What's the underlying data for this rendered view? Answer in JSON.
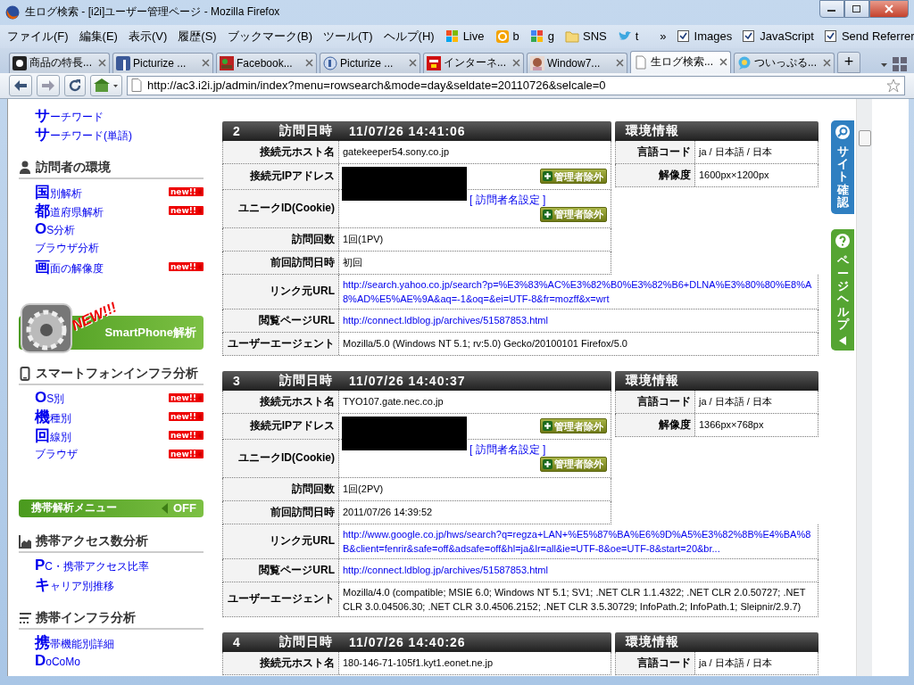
{
  "window": {
    "title": "生ログ検索 - [i2i]ユーザー管理ページ - Mozilla Firefox"
  },
  "menu": [
    "ファイル(F)",
    "編集(E)",
    "表示(V)",
    "履歴(S)",
    "ブックマーク(B)",
    "ツール(T)",
    "ヘルプ(H)"
  ],
  "bookmarks": [
    {
      "label": "Live",
      "kind": "flag"
    },
    {
      "label": "b",
      "kind": "ring"
    },
    {
      "label": "g",
      "kind": "tiles"
    },
    {
      "label": "SNS",
      "kind": "folder"
    },
    {
      "label": "t",
      "kind": "bird"
    }
  ],
  "overflow": "»",
  "toggles": [
    {
      "label": "Images",
      "checked": true
    },
    {
      "label": "JavaScript",
      "checked": true
    },
    {
      "label": "Send Referrer",
      "checked": true
    }
  ],
  "tabs": [
    {
      "label": "商品の特長...",
      "kind": "dark",
      "selected": false
    },
    {
      "label": "Picturize ...",
      "kind": "blue",
      "selected": false
    },
    {
      "label": "Facebook...",
      "kind": "photo",
      "selected": false
    },
    {
      "label": "Picturize ...",
      "kind": "circle",
      "selected": false
    },
    {
      "label": "インターネ...",
      "kind": "red",
      "selected": false
    },
    {
      "label": "Window7...",
      "kind": "avatar",
      "selected": false
    },
    {
      "label": "生ログ検索...",
      "kind": "page",
      "selected": true
    },
    {
      "label": "ついっぷる...",
      "kind": "bubble",
      "selected": false
    }
  ],
  "new_tab": "+",
  "url": "http://ac3.i2i.jp/admin/index?menu=rowsearch&mode=day&seldate=20110726&selcale=0",
  "sidebar": [
    {
      "kind": "links",
      "items": [
        {
          "label": "サーチワード",
          "initial": true
        },
        {
          "label": "サーチワード(単語)",
          "initial": true
        }
      ]
    },
    {
      "kind": "visitors",
      "title": "訪問者の環境",
      "items": [
        {
          "label": "国別解析",
          "initial": true,
          "badge": "new!!"
        },
        {
          "label": "都道府県解析",
          "initial": true,
          "badge": "new!!"
        },
        {
          "label": "OS分析",
          "initial": true
        },
        {
          "label": "ブラウザ分析",
          "initial": false
        },
        {
          "label": "画面の解像度",
          "initial": true,
          "badge": "new!!"
        }
      ]
    },
    {
      "kind": "banner",
      "tag": "NEW!!!",
      "label": "SmartPhone解析"
    },
    {
      "kind": "smartphone",
      "title": "スマートフォンインフラ分析",
      "items": [
        {
          "label": "OS別",
          "initial": true,
          "badge": "new!!"
        },
        {
          "label": "機種別",
          "initial": true,
          "badge": "new!!"
        },
        {
          "label": "回線別",
          "initial": true,
          "badge": "new!!"
        },
        {
          "label": "ブラウザ",
          "initial": false,
          "badge": "new!!"
        }
      ]
    },
    {
      "kind": "toggle",
      "label": "携帯解析メニュー",
      "state": "OFF"
    },
    {
      "kind": "access",
      "title": "携帯アクセス数分析",
      "items": [
        {
          "label": "PC・携帯アクセス比率",
          "initial": true
        },
        {
          "label": "キャリア別推移",
          "initial": true
        }
      ]
    },
    {
      "kind": "infra",
      "title": "携帯インフラ分析",
      "items": [
        {
          "label": "携帯機能別詳細",
          "initial": true
        },
        {
          "label": "DoCoMo",
          "initial": true
        }
      ]
    }
  ],
  "visits": [
    {
      "number": "2",
      "date_label": "訪問日時",
      "datetime": "11/07/26 14:41:06",
      "env_title": "環境情報",
      "rows": [
        {
          "kind": "text",
          "label": "接続元ホスト名",
          "value": "gatekeeper54.sony.co.jp"
        },
        {
          "kind": "ip",
          "label": "接続元IPアドレス",
          "button": "管理者除外"
        },
        {
          "kind": "cookie",
          "label": "ユニークID(Cookie)",
          "link": "[ 訪問者名設定 ]",
          "button": "管理者除外"
        },
        {
          "kind": "text",
          "label": "訪問回数",
          "value": "1回(1PV)"
        },
        {
          "kind": "text",
          "label": "前回訪問日時",
          "value": "初回"
        }
      ],
      "wide_rows": [
        {
          "kind": "link",
          "label": "リンク元URL",
          "value": "http://search.yahoo.co.jp/search?p=%E3%83%AC%E3%82%B0%E3%82%B6+DLNA%E3%80%80%E8%A8%AD%E5%AE%9A&aq=-1&oq=&ei=UTF-8&fr=mozff&x=wrt"
        },
        {
          "kind": "link",
          "label": "閲覧ページURL",
          "value": "http://connect.ldblog.jp/archives/51587853.html"
        },
        {
          "kind": "text",
          "label": "ユーザーエージェント",
          "value": "Mozilla/5.0 (Windows NT 5.1; rv:5.0) Gecko/20100101 Firefox/5.0"
        }
      ],
      "env": [
        {
          "label": "言語コード",
          "value": "ja / 日本語 / 日本"
        },
        {
          "label": "解像度",
          "value": "1600px×1200px"
        }
      ]
    },
    {
      "number": "3",
      "date_label": "訪問日時",
      "datetime": "11/07/26 14:40:37",
      "env_title": "環境情報",
      "rows": [
        {
          "kind": "text",
          "label": "接続元ホスト名",
          "value": "TYO107.gate.nec.co.jp"
        },
        {
          "kind": "ip",
          "label": "接続元IPアドレス",
          "button": "管理者除外"
        },
        {
          "kind": "cookie",
          "label": "ユニークID(Cookie)",
          "link": "[ 訪問者名設定 ]",
          "button": "管理者除外"
        },
        {
          "kind": "text",
          "label": "訪問回数",
          "value": "1回(2PV)"
        },
        {
          "kind": "text",
          "label": "前回訪問日時",
          "value": "2011/07/26 14:39:52"
        }
      ],
      "wide_rows": [
        {
          "kind": "link",
          "label": "リンク元URL",
          "value": "http://www.google.co.jp/hws/search?q=regza+LAN+%E5%87%BA%E6%9D%A5%E3%82%8B%E4%BA%8B&client=fenrir&safe=off&adsafe=off&hl=ja&lr=all&ie=UTF-8&oe=UTF-8&start=20&br..."
        },
        {
          "kind": "link",
          "label": "閲覧ページURL",
          "value": "http://connect.ldblog.jp/archives/51587853.html"
        },
        {
          "kind": "text",
          "label": "ユーザーエージェント",
          "value": "Mozilla/4.0 (compatible; MSIE 6.0; Windows NT 5.1; SV1; .NET CLR 1.1.4322; .NET CLR 2.0.50727; .NET CLR 3.0.04506.30; .NET CLR 3.0.4506.2152; .NET CLR 3.5.30729; InfoPath.2; InfoPath.1; Sleipnir/2.9.7)"
        }
      ],
      "env": [
        {
          "label": "言語コード",
          "value": "ja / 日本語 / 日本"
        },
        {
          "label": "解像度",
          "value": "1366px×768px"
        }
      ]
    },
    {
      "number": "4",
      "date_label": "訪問日時",
      "datetime": "11/07/26 14:40:26",
      "env_title": "環境情報",
      "rows": [
        {
          "kind": "text",
          "label": "接続元ホスト名",
          "value": "180-146-71-105f1.kyt1.eonet.ne.jp"
        }
      ],
      "env": [
        {
          "label": "言語コード",
          "value": "ja / 日本語 / 日本"
        }
      ]
    }
  ],
  "side_tabs": [
    {
      "label": "サイト確認",
      "kind": "search",
      "color": "#2f7fc1"
    },
    {
      "label": "ページヘルプ",
      "kind": "help",
      "color": "#55a532"
    }
  ]
}
